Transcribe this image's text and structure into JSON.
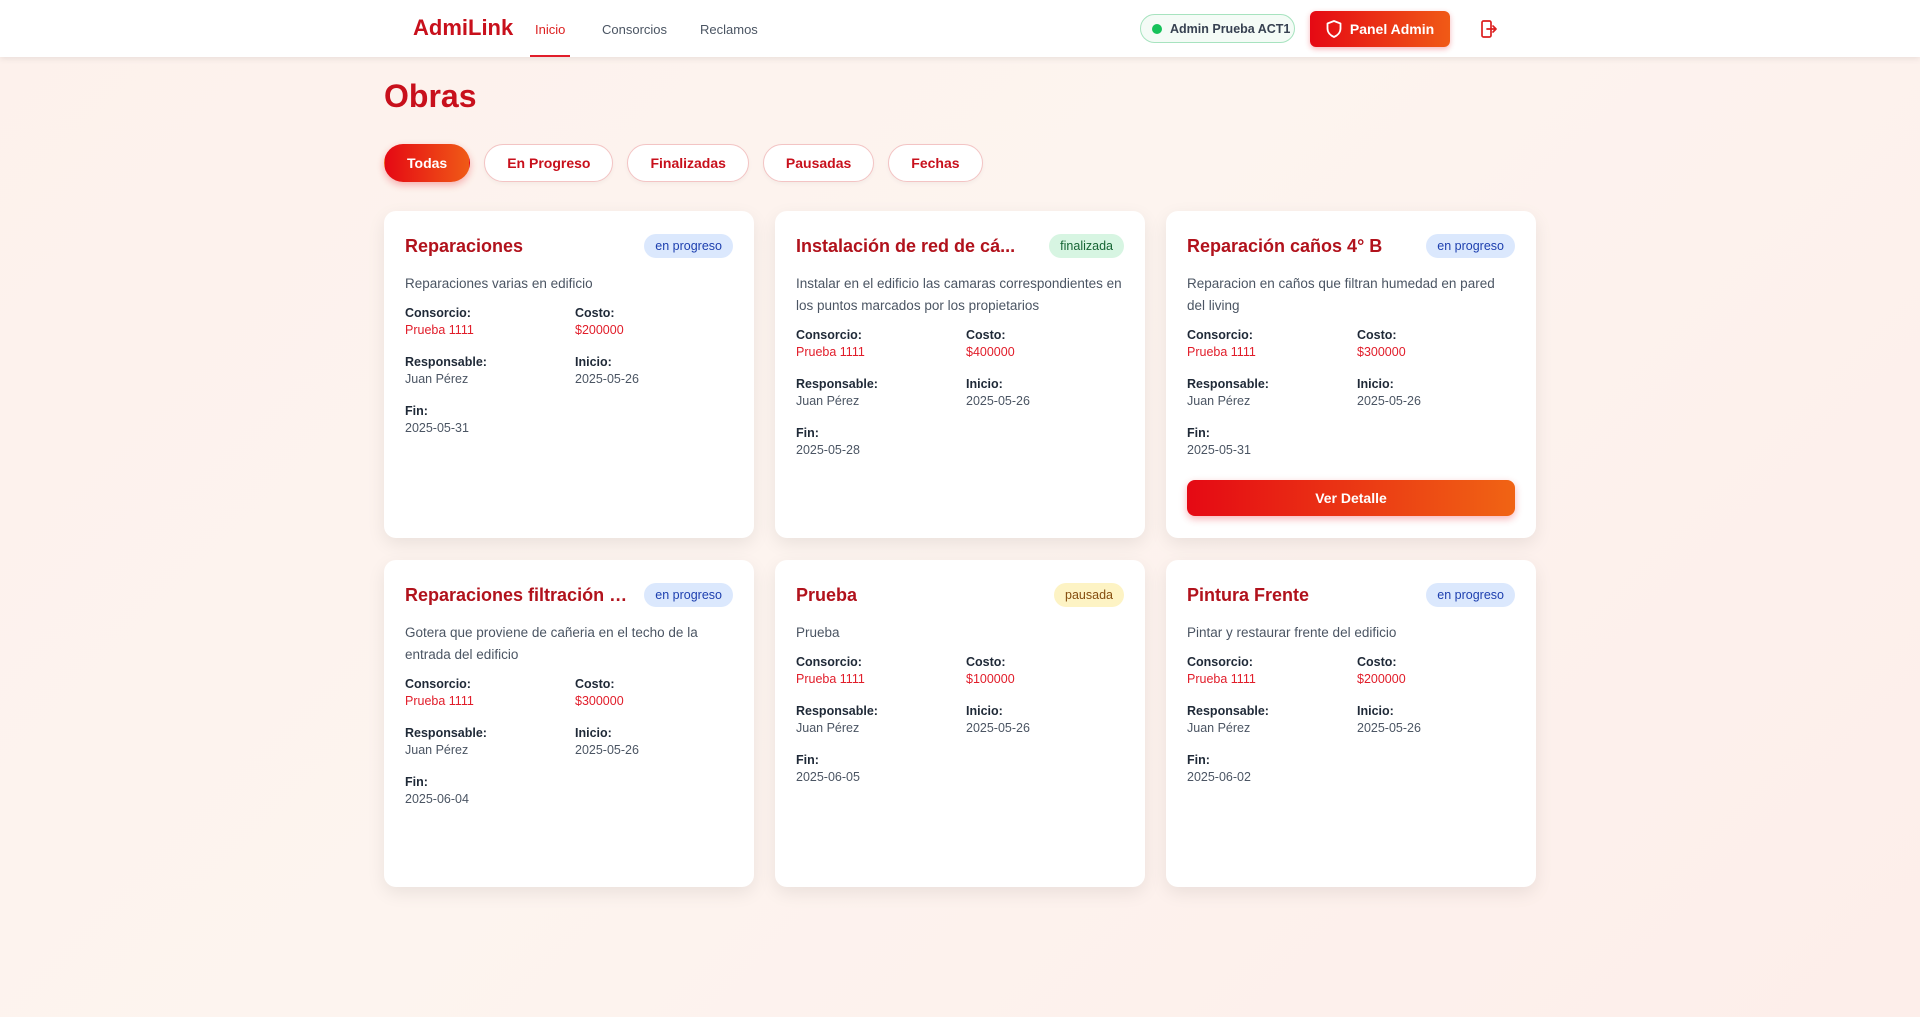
{
  "nav": {
    "brand": "AdmiLink",
    "links": [
      "Inicio",
      "Consorcios",
      "Reclamos"
    ],
    "user": "Admin Prueba ACT1",
    "admin_button": "Panel Admin"
  },
  "page": {
    "title": "Obras"
  },
  "filters": [
    "Todas",
    "En Progreso",
    "Finalizadas",
    "Pausadas",
    "Fechas"
  ],
  "labels": {
    "consorcio": "Consorcio:",
    "costo": "Costo:",
    "responsable": "Responsable:",
    "inicio": "Inicio:",
    "fin": "Fin:"
  },
  "detail_button": "Ver Detalle",
  "cards": [
    {
      "title": "Reparaciones",
      "status": "en progreso",
      "description": "Reparaciones varias en edificio",
      "consorcio": "Prueba 1111",
      "costo": "$200000",
      "responsable": "Juan Pérez",
      "inicio": "2025-05-26",
      "fin": "2025-05-31"
    },
    {
      "title": "Instalación de red de cá...",
      "status": "finalizada",
      "description": "Instalar en el edificio las camaras correspondientes en los puntos marcados por los propietarios",
      "consorcio": "Prueba 1111",
      "costo": "$400000",
      "responsable": "Juan Pérez",
      "inicio": "2025-05-26",
      "fin": "2025-05-28"
    },
    {
      "title": "Reparación caños 4° B",
      "status": "en progreso",
      "description": "Reparacion en caños que filtran humedad en pared del living",
      "consorcio": "Prueba 1111",
      "costo": "$300000",
      "responsable": "Juan Pérez",
      "inicio": "2025-05-26",
      "fin": "2025-05-31"
    },
    {
      "title": "Reparaciones filtración e...",
      "status": "en progreso",
      "description": "Gotera que proviene de cañeria en el techo de la entrada del edificio",
      "consorcio": "Prueba 1111",
      "costo": "$300000",
      "responsable": "Juan Pérez",
      "inicio": "2025-05-26",
      "fin": "2025-06-04"
    },
    {
      "title": "Prueba",
      "status": "pausada",
      "description": "Prueba",
      "consorcio": "Prueba 1111",
      "costo": "$100000",
      "responsable": "Juan Pérez",
      "inicio": "2025-05-26",
      "fin": "2025-06-05"
    },
    {
      "title": "Pintura Frente",
      "status": "en progreso",
      "description": "Pintar y restaurar frente del edificio",
      "consorcio": "Prueba 1111",
      "costo": "$200000",
      "responsable": "Juan Pérez",
      "inicio": "2025-05-26",
      "fin": "2025-06-02"
    }
  ],
  "colors": {
    "brand": "#c8101c",
    "accent_gradient_start": "#e50914",
    "accent_gradient_end": "#f05a16",
    "online": "#16c25a"
  },
  "icons": {
    "admin": "shield-icon",
    "logout": "logout-icon",
    "status": "online-dot-icon"
  }
}
